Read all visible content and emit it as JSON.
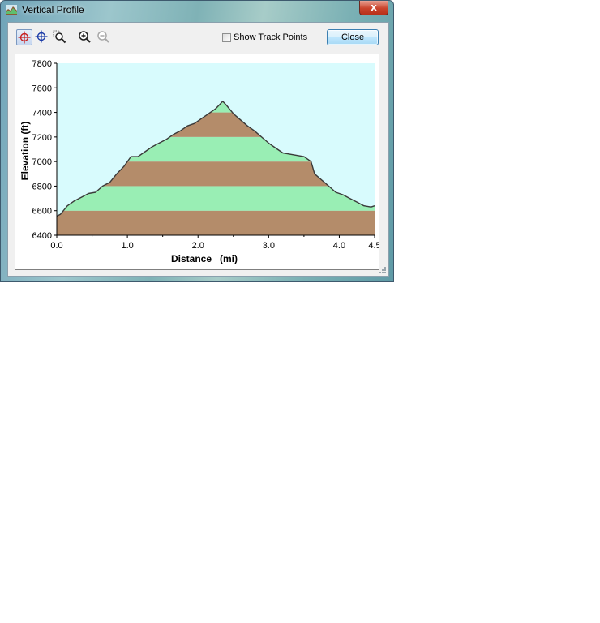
{
  "window": {
    "title": "Vertical Profile",
    "close_glyph": "x",
    "icon": "vertical-profile-app-icon"
  },
  "toolbar": {
    "tools": [
      {
        "name": "crosshair-select-tool",
        "icon": "crosshair-red-icon",
        "active": true
      },
      {
        "name": "crosshair-move-tool",
        "icon": "crosshair-blue-icon",
        "active": false
      },
      {
        "name": "zoom-box-tool",
        "icon": "zoom-box-icon",
        "active": false
      },
      {
        "name": "zoom-in-tool",
        "icon": "zoom-in-icon",
        "active": false
      },
      {
        "name": "zoom-out-tool",
        "icon": "zoom-out-icon",
        "active": false,
        "disabled": true
      }
    ],
    "show_track_points_label": "Show Track Points",
    "show_track_points_checked": false,
    "close_label": "Close"
  },
  "chart_data": {
    "type": "area",
    "xlabel": "Distance   (mi)",
    "ylabel": "Elevation (ft)",
    "xlim": [
      0.0,
      4.5
    ],
    "ylim": [
      6400,
      7800
    ],
    "xticks": [
      "0.0",
      "1.0",
      "2.0",
      "3.0",
      "4.0",
      "4.5"
    ],
    "yticks": [
      "6400",
      "6600",
      "6800",
      "7000",
      "7200",
      "7400",
      "7600",
      "7800"
    ],
    "grid": false,
    "colors": {
      "sky": "#d8fbfd",
      "band_brown": "#b48c6a",
      "band_green": "#99eeb4",
      "profile_line": "#3a3a3a"
    },
    "band_height_ft": 200,
    "x": [
      0.0,
      0.05,
      0.15,
      0.25,
      0.35,
      0.45,
      0.55,
      0.65,
      0.75,
      0.85,
      0.95,
      1.05,
      1.15,
      1.25,
      1.35,
      1.45,
      1.55,
      1.65,
      1.75,
      1.85,
      1.95,
      2.05,
      2.15,
      2.25,
      2.35,
      2.4,
      2.5,
      2.6,
      2.7,
      2.8,
      2.9,
      3.0,
      3.1,
      3.2,
      3.3,
      3.4,
      3.5,
      3.6,
      3.65,
      3.75,
      3.85,
      3.95,
      4.05,
      4.15,
      4.25,
      4.35,
      4.45,
      4.5
    ],
    "y": [
      6555,
      6570,
      6640,
      6680,
      6710,
      6740,
      6750,
      6800,
      6830,
      6900,
      6960,
      7040,
      7040,
      7080,
      7120,
      7150,
      7180,
      7220,
      7250,
      7290,
      7310,
      7350,
      7390,
      7430,
      7490,
      7460,
      7390,
      7340,
      7290,
      7250,
      7200,
      7150,
      7110,
      7070,
      7060,
      7050,
      7040,
      7000,
      6900,
      6850,
      6800,
      6750,
      6730,
      6700,
      6670,
      6640,
      6630,
      6640
    ]
  }
}
